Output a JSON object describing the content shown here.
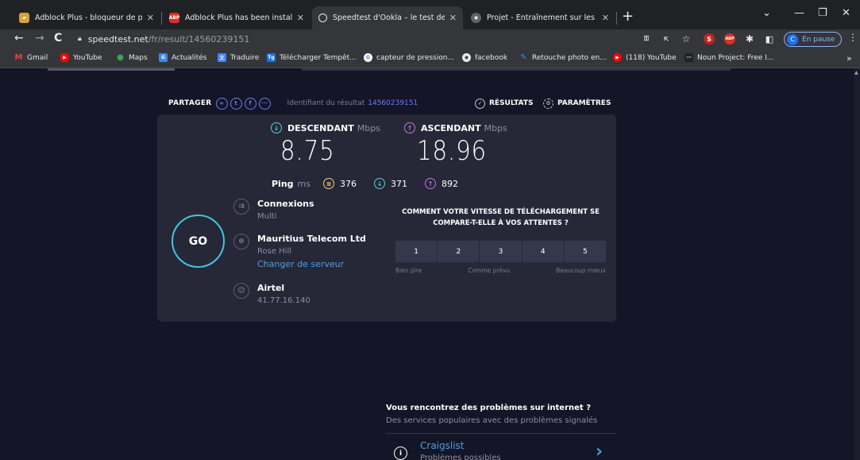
{
  "browser": {
    "tabs": [
      {
        "title": "Adblock Plus - bloqueur de publ",
        "icon": "adblock-store-icon",
        "color": "#d4a23a"
      },
      {
        "title": "Adblock Plus has been installed!",
        "icon": "abp-icon",
        "color": "#d93025"
      },
      {
        "title": "Speedtest d'Ookla – le test de vit",
        "icon": "speedtest-icon",
        "color": "#e8eaed"
      },
      {
        "title": "Projet - Entraînement sur les bas",
        "icon": "globe-icon",
        "color": "#e8eaed"
      }
    ],
    "url_domain": "speedtest.net",
    "url_path": "/fr/result/14560239151",
    "profile_initial": "C",
    "profile_label": "En pause",
    "bookmarks": [
      {
        "label": "Gmail",
        "color": "#ea4335"
      },
      {
        "label": "YouTube",
        "color": "#ff0000"
      },
      {
        "label": "Maps",
        "color": "#34a853"
      },
      {
        "label": "Actualités",
        "color": "#4285f4"
      },
      {
        "label": "Traduire",
        "color": "#4285f4"
      },
      {
        "label": "Télécharger Tempêt...",
        "color": "#1a73e8"
      },
      {
        "label": "capteur de pression...",
        "color": "#4285f4"
      },
      {
        "label": "facebook",
        "color": "#e8eaed"
      },
      {
        "label": "Retouche photo en...",
        "color": "#4285f4"
      },
      {
        "label": "(118) YouTube",
        "color": "#ff0000"
      },
      {
        "label": "Noun Project: Free I...",
        "color": "#222222"
      }
    ]
  },
  "share": {
    "label": "PARTAGER",
    "result_id_label": "Identifiant du résultat",
    "result_id": "14560239151",
    "results_label": "RÉSULTATS",
    "settings_label": "PARAMÈTRES"
  },
  "download": {
    "label": "DESCENDANT",
    "unit": "Mbps",
    "value": "8.75"
  },
  "upload": {
    "label": "ASCENDANT",
    "unit": "Mbps",
    "value": "18.96"
  },
  "ping": {
    "label": "Ping",
    "unit": "ms",
    "idle": "376",
    "download": "371",
    "upload": "892"
  },
  "go_label": "GO",
  "connections": {
    "title": "Connexions",
    "value": "Multi"
  },
  "server": {
    "name": "Mauritius Telecom Ltd",
    "location": "Rose Hill",
    "change_label": "Changer de serveur"
  },
  "isp": {
    "name": "Airtel",
    "ip": "41.77.16.140"
  },
  "survey": {
    "question": "COMMENT VOTRE VITESSE DE TÉLÉCHARGEMENT SE COMPARE-T-ELLE À VOS ATTENTES ?",
    "options": [
      "1",
      "2",
      "3",
      "4",
      "5"
    ],
    "legend_low": "Bien pire",
    "legend_mid": "Comme prévu",
    "legend_high": "Beaucoup mieux"
  },
  "problems": {
    "heading": "Vous rencontrez des problèmes sur internet ?",
    "subheading": "Des services populaires avec des problèmes signalés",
    "item_name": "Craigslist",
    "item_sub": "Problèmes possibles"
  },
  "colors": {
    "download": "#52d2d9",
    "upload": "#c86fe3",
    "ping": "#f3d36b",
    "accent": "#6d7bf7",
    "link": "#4b9ee6",
    "go_ring": "#45c4de"
  }
}
